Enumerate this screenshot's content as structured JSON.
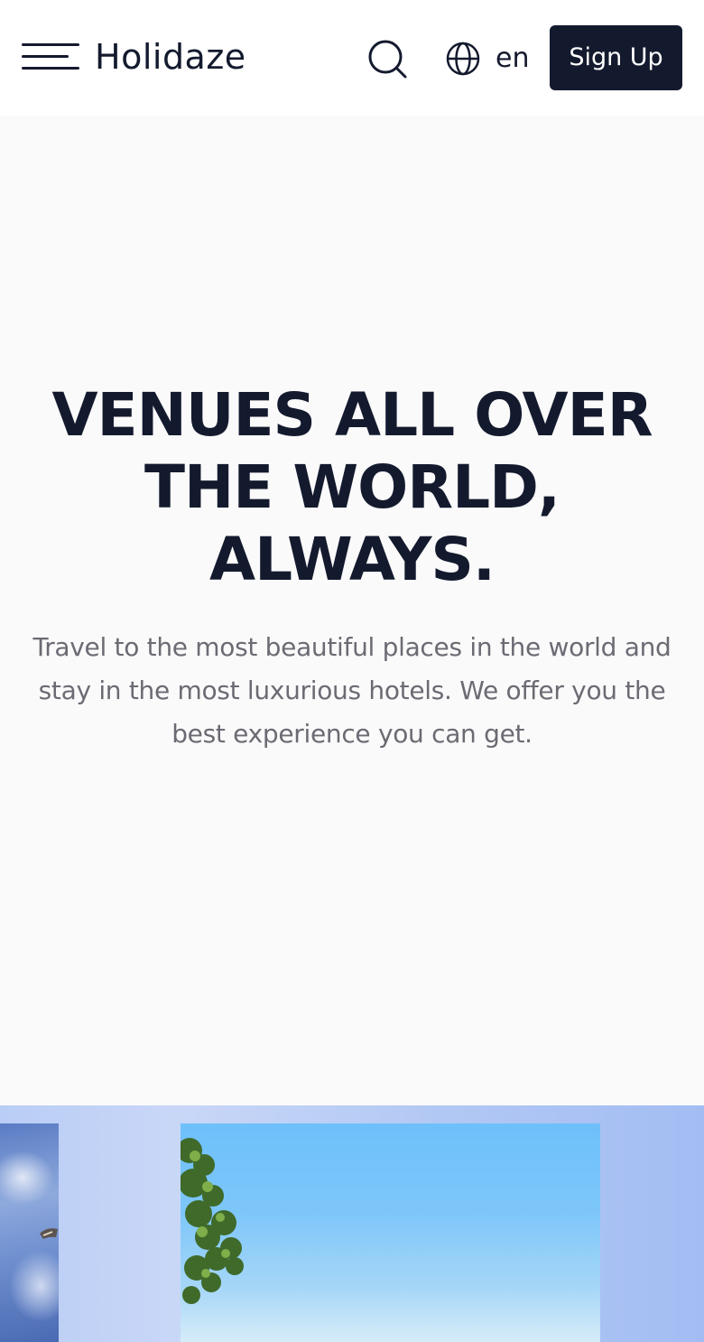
{
  "header": {
    "menu_icon": "hamburger-menu-icon",
    "logo": "Holidaze",
    "search_icon": "search-icon",
    "language_icon": "globe-icon",
    "language": "en",
    "signup_label": "Sign Up"
  },
  "hero": {
    "title": "VENUES ALL OVER THE WORLD, ALWAYS.",
    "subtitle": "Travel to the most beautiful places in the world and stay in the most luxurious hotels. We offer you the best experience you can get."
  },
  "colors": {
    "primary": "#141a2e",
    "background": "#fafafa",
    "muted_text": "#6b6b74",
    "gallery_bg": "#b9cdf6"
  }
}
